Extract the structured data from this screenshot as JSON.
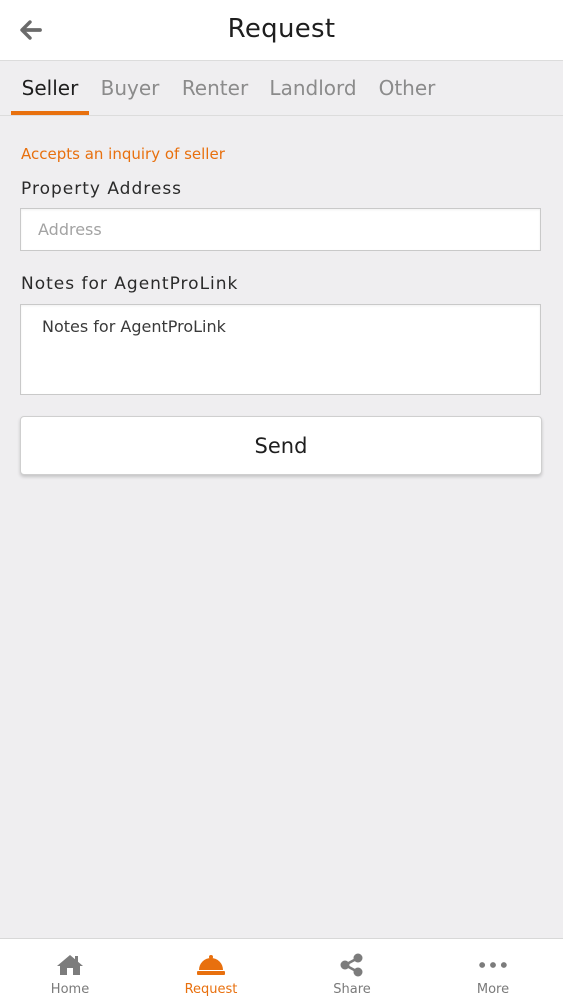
{
  "header": {
    "title": "Request",
    "back_icon": "arrow-left-icon"
  },
  "tabs": [
    {
      "label": "Seller",
      "active": true
    },
    {
      "label": "Buyer",
      "active": false
    },
    {
      "label": "Renter",
      "active": false
    },
    {
      "label": "Landlord",
      "active": false
    },
    {
      "label": "Other",
      "active": false
    }
  ],
  "form": {
    "hint": "Accepts an inquiry of seller",
    "address_label": "Property Address",
    "address_placeholder": "Address",
    "address_value": "",
    "notes_label": "Notes for AgentProLink",
    "notes_placeholder": "Notes for AgentProLink",
    "notes_value": "",
    "send_label": "Send"
  },
  "bottom_nav": [
    {
      "label": "Home",
      "icon": "home-icon",
      "active": false
    },
    {
      "label": "Request",
      "icon": "bell-icon",
      "active": true
    },
    {
      "label": "Share",
      "icon": "share-icon",
      "active": false
    },
    {
      "label": "More",
      "icon": "more-icon",
      "active": false
    }
  ],
  "colors": {
    "accent": "#e8700e",
    "background": "#efeef0",
    "inactive": "#7a7a7a"
  }
}
